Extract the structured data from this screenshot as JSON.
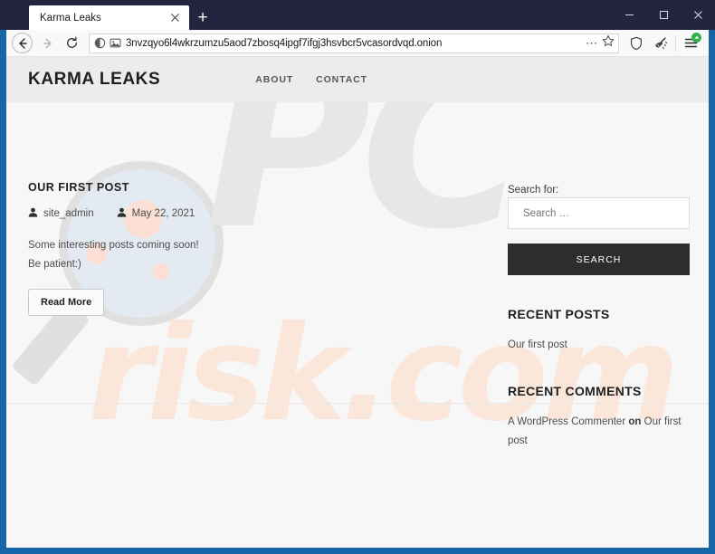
{
  "browser": {
    "tab": {
      "title": "Karma Leaks",
      "close_icon": "close-icon"
    },
    "new_tab_label": "+",
    "window_controls": {
      "minimize": "─",
      "maximize": "□",
      "close": "✕"
    },
    "nav": {
      "back_icon": "back-arrow-icon",
      "forward_icon": "forward-arrow-icon",
      "reload_icon": "reload-icon"
    },
    "urlbar": {
      "permissions_icon": "half-circle-permissions-icon",
      "image_icon": "image-placeholder-icon",
      "url": "3nvzqyo6l4wkrzumzu5aod7zbosq4ipgf7ifgj3hsvbcr5vcasordvqd.onion",
      "bookmark_icon": "star-icon",
      "page_actions_icon": "ellipsis-icon"
    },
    "toolbar": {
      "shield_icon": "shield-icon",
      "new_identity_icon": "broom-icon",
      "menu_icon": "hamburger-menu-icon",
      "menu_badge_icon": "update-available-badge"
    }
  },
  "site": {
    "title": "KARMA LEAKS",
    "nav": [
      {
        "label": "ABOUT"
      },
      {
        "label": "CONTACT"
      }
    ]
  },
  "post": {
    "title": "OUR FIRST POST",
    "author": "site_admin",
    "author_icon": "person-icon",
    "date": "May 22, 2021",
    "date_icon": "person-icon",
    "body_line1": "Some interesting posts coming soon!",
    "body_line2": "Be patient:)",
    "read_more_label": "Read More"
  },
  "sidebar": {
    "search": {
      "label": "Search for:",
      "placeholder": "Search …",
      "value": "",
      "button_label": "SEARCH"
    },
    "recent_posts": {
      "title": "RECENT POSTS",
      "items": [
        {
          "label": "Our first post"
        }
      ]
    },
    "recent_comments": {
      "title": "RECENT COMMENTS",
      "author": "A WordPress Commenter",
      "connector": "on",
      "post": "Our first post"
    }
  },
  "watermark": {
    "text_primary": "PC",
    "text_secondary": "risk.com"
  },
  "colors": {
    "window_border": "#1565a8",
    "titlebar": "#24243f",
    "site_header": "#ececec",
    "search_button": "#2d2d2d",
    "page_background": "#f7f7f7",
    "badge_green": "#30b148"
  }
}
